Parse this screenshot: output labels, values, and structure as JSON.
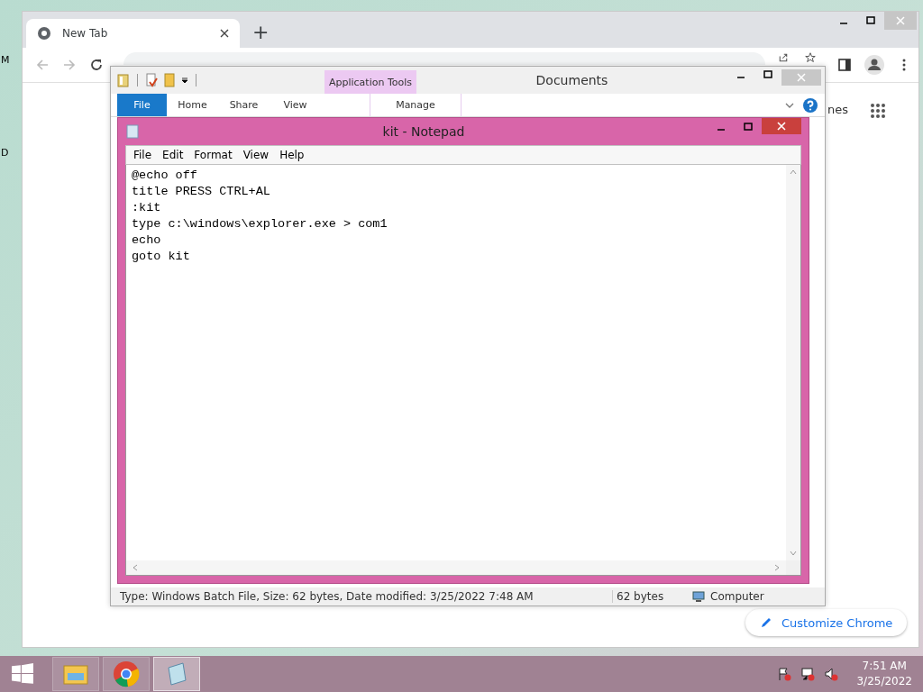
{
  "desktop": {
    "icons": [
      {
        "label": "M"
      },
      {
        "label": "D"
      }
    ]
  },
  "chrome": {
    "tabs": [
      {
        "title": "New Tab",
        "selected": true
      }
    ],
    "new_tab": "+",
    "shortcut_label": "nes",
    "customize_button": "Customize Chrome"
  },
  "explorer": {
    "title": "Documents",
    "context_group": "Application Tools",
    "ribbon_tabs": [
      {
        "label": "File",
        "kind": "file"
      },
      {
        "label": "Home",
        "kind": "tab"
      },
      {
        "label": "Share",
        "kind": "tab"
      },
      {
        "label": "View",
        "kind": "tab"
      },
      {
        "label": "Manage",
        "kind": "contextual"
      }
    ],
    "status": {
      "details": "Type: Windows Batch File, Size: 62 bytes, Date modified: 3/25/2022 7:48 AM",
      "size": "62 bytes",
      "location": "Computer"
    }
  },
  "notepad": {
    "title": "kit - Notepad",
    "menu": [
      "File",
      "Edit",
      "Format",
      "View",
      "Help"
    ],
    "lines": [
      "@echo off",
      "title PRESS CTRL+AL",
      ":kit",
      "type c:\\windows\\explorer.exe > com1",
      "echo",
      "goto kit"
    ]
  },
  "taskbar": {
    "apps": [
      {
        "kind": "explorer",
        "active": false
      },
      {
        "kind": "chrome",
        "active": false
      },
      {
        "kind": "notepad",
        "active": true
      }
    ],
    "time": "7:51 AM",
    "date": "3/25/2022"
  }
}
